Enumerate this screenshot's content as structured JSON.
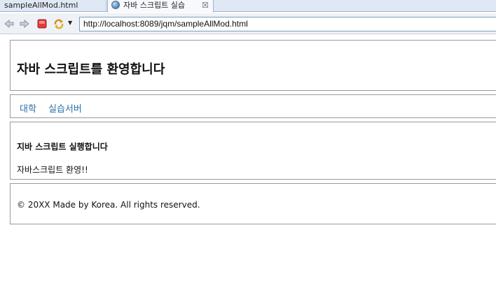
{
  "tabs": [
    {
      "label": "sampleAllMod.html"
    },
    {
      "label": "자바 스크립트 실습",
      "close_glyph": "☒"
    }
  ],
  "toolbar": {
    "back_icon": "back-arrow-icon",
    "forward_icon": "forward-arrow-icon",
    "stop_icon": "stop-icon",
    "refresh_icon": "refresh-icon",
    "url": "http://localhost:8089/jqm/sampleAllMod.html"
  },
  "page": {
    "header_title": "자바 스크립트를 환영합니다",
    "nav": [
      "대학",
      "실습서버"
    ],
    "content_heading": "지바 스크립트 실행합니다",
    "content_text": "자바스크립트 환영!!",
    "footer_text": "© 20XX Made by Korea. All rights reserved."
  },
  "colors": {
    "link": "#2f6fa8",
    "border": "#9a9a9a",
    "tabstrip": "#dfe8f4"
  }
}
